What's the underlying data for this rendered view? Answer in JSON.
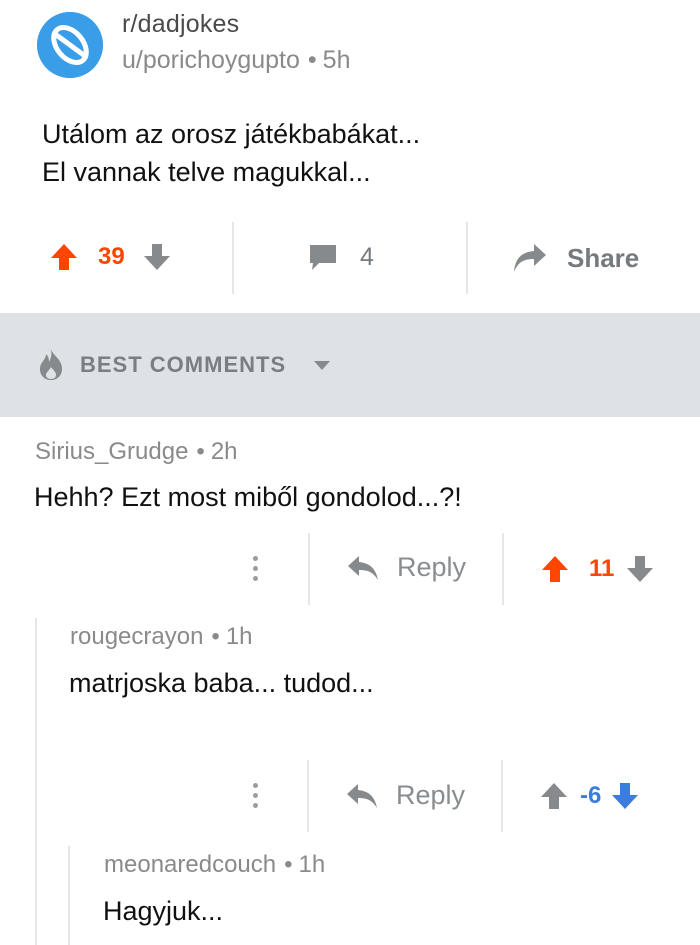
{
  "post": {
    "subreddit": "r/dadjokes",
    "author": "u/porichoygupto",
    "age": "5h",
    "separator": "•",
    "lines": [
      "Utálom az orosz játékbabákat...",
      "El vannak telve magukkal..."
    ],
    "score": "39",
    "comment_count": "4",
    "share_label": "Share"
  },
  "sort": {
    "label": "BEST COMMENTS"
  },
  "comments": [
    {
      "author": "Sirius_Grudge",
      "age": "2h",
      "text": "Hehh? Ezt most miből gondolod...?!",
      "reply_label": "Reply",
      "score": "11",
      "vote_state": "upvoted"
    },
    {
      "author": "rougecrayon",
      "age": "1h",
      "text": "matrjoska baba... tudod...",
      "reply_label": "Reply",
      "score": "-6",
      "vote_state": "downvoted"
    },
    {
      "author": "meonaredcouch",
      "age": "1h",
      "text": "Hagyjuk..."
    }
  ],
  "colors": {
    "upvote": "#ff4500",
    "downvote": "#3c7be0",
    "neutral_icon": "#878a8c",
    "band": "#dee2e6",
    "subreddit_avatar": "#3a9de8"
  },
  "icons": {
    "subreddit": "planet-icon",
    "comments": "speech-bubble-icon",
    "share": "share-arrow-icon",
    "sort": "flame-icon",
    "more": "kebab-icon",
    "reply": "reply-arrow-icon"
  }
}
